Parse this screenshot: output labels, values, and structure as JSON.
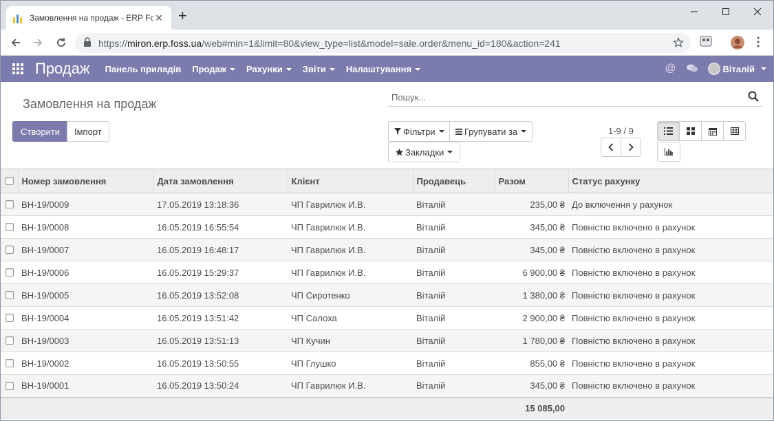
{
  "browser": {
    "tab_title": "Замовлення на продаж - ERP Fo",
    "url_scheme": "https://",
    "url_host": "miron.erp.foss.ua",
    "url_rest": "/web#min=1&limit=80&view_type=list&model=sale.order&menu_id=180&action=241"
  },
  "navbar": {
    "brand": "Продаж",
    "menu": [
      "Панель приладів",
      "Продаж",
      "Рахунки",
      "Звіти",
      "Налаштування"
    ],
    "user": "Віталій",
    "color": "#7c7bad"
  },
  "control": {
    "breadcrumb": "Замовлення на продаж",
    "search_placeholder": "Пошук...",
    "create_label": "Створити",
    "import_label": "Імпорт",
    "filters_label": "Фільтри",
    "group_by_label": "Групувати за",
    "favorites_label": "Закладки",
    "pager": "1-9 / 9"
  },
  "table": {
    "columns": [
      "Номер замовлення",
      "Дата замовлення",
      "Клієнт",
      "Продавець",
      "Разом",
      "Статус рахунку"
    ],
    "rows": [
      [
        "ВН-19/0009",
        "17.05.2019 13:18:36",
        "ЧП Гаврилюк И.В.",
        "Віталій",
        "235,00 ₴",
        "До включення у рахунок"
      ],
      [
        "ВН-19/0008",
        "16.05.2019 16:55:54",
        "ЧП Гаврилюк И.В.",
        "Віталій",
        "345,00 ₴",
        "Повністю включено в рахунок"
      ],
      [
        "ВН-19/0007",
        "16.05.2019 16:48:17",
        "ЧП Гаврилюк И.В.",
        "Віталій",
        "345,00 ₴",
        "Повністю включено в рахунок"
      ],
      [
        "ВН-19/0006",
        "16.05.2019 15:29:37",
        "ЧП Гаврилюк И.В.",
        "Віталій",
        "6 900,00 ₴",
        "Повністю включено в рахунок"
      ],
      [
        "ВН-19/0005",
        "16.05.2019 13:52:08",
        "ЧП Сиротенко",
        "Віталій",
        "1 380,00 ₴",
        "Повністю включено в рахунок"
      ],
      [
        "ВН-19/0004",
        "16.05.2019 13:51:42",
        "ЧП Салоха",
        "Віталій",
        "2 900,00 ₴",
        "Повністю включено в рахунок"
      ],
      [
        "ВН-19/0003",
        "16.05.2019 13:51:13",
        "ЧП Кучин",
        "Віталій",
        "1 780,00 ₴",
        "Повністю включено в рахунок"
      ],
      [
        "ВН-19/0002",
        "16.05.2019 13:50:55",
        "ЧП Глушко",
        "Віталій",
        "855,00 ₴",
        "Повністю включено в рахунок"
      ],
      [
        "ВН-19/0001",
        "16.05.2019 13:50:24",
        "ЧП Гаврилюк И.В.",
        "Віталій",
        "345,00 ₴",
        "Повністю включено в рахунок"
      ]
    ],
    "total": "15 085,00"
  }
}
